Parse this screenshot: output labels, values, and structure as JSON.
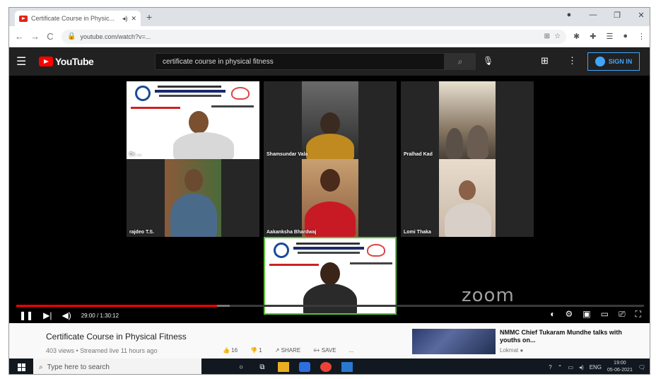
{
  "browser": {
    "tab_title": "Certificate Course in Physic...",
    "tab_icons": [
      "speaker-icon",
      "close-icon"
    ],
    "new_tab": "+",
    "window_controls": [
      "minimize-icon",
      "restore-icon",
      "close-icon"
    ],
    "url": "youtube.com/watch?v=...",
    "back": "←",
    "forward": "→",
    "reload": "C"
  },
  "youtube": {
    "logo_text": "YouTube",
    "search_value": "certificate course in physical fitness",
    "sign_in": "SIGN IN"
  },
  "video": {
    "participants": [
      {
        "name": "Dr. ...",
        "kind": "slide"
      },
      {
        "name": "Shamsundar Vala",
        "kind": "person"
      },
      {
        "name": "Pralhad Kad",
        "kind": "room"
      },
      {
        "name": "rajdeo T.S.",
        "kind": "person"
      },
      {
        "name": "Aakanksha Bhardwaj",
        "kind": "person"
      },
      {
        "name": "Lomi Thaka",
        "kind": "person"
      },
      {
        "name": "",
        "kind": "slide"
      }
    ],
    "watermark": "zoom",
    "time": "29:00 / 1:30:12",
    "progress_fraction": 0.32,
    "buffered_fraction": 0.34,
    "accent": "#ff0000"
  },
  "below": {
    "title": "Certificate Course in Physical Fitness",
    "meta": "403 views • Streamed live 11 hours ago",
    "actions": [
      "👍 16",
      "👎 1",
      "↗ SHARE",
      "≡+ SAVE",
      "..."
    ],
    "recommended": {
      "title": "NMMC Chief Tukaram Mundhe talks with youths on...",
      "channel": "Lokmat ●"
    }
  },
  "taskbar": {
    "search_placeholder": "Type here to search",
    "lang": "ENG",
    "time": "19:00",
    "date": "05-06-2021"
  }
}
